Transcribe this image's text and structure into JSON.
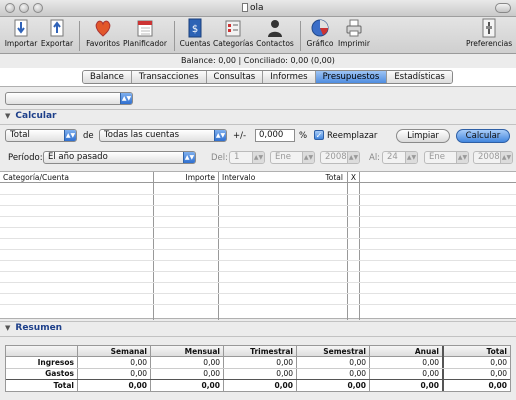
{
  "window": {
    "title": "ola"
  },
  "toolbar": {
    "importar": "Importar",
    "exportar": "Exportar",
    "favoritos": "Favoritos",
    "planificador": "Planificador",
    "cuentas": "Cuentas",
    "categorias": "Categorías",
    "contactos": "Contactos",
    "grafico": "Gráfico",
    "imprimir": "Imprimir",
    "preferencias": "Preferencias"
  },
  "balance_bar": "Balance: 0,00 | Conciliado: 0,00 (0,00)",
  "tabs": [
    "Balance",
    "Transacciones",
    "Consultas",
    "Informes",
    "Presupuestos",
    "Estadísticas"
  ],
  "active_tab": "Presupuestos",
  "calcular_section": {
    "title": "Calcular",
    "type_select": "Total",
    "de_label": "de",
    "accounts_select": "Todas las cuentas",
    "plusminus_label": "+/-",
    "percent_value": "0,000",
    "percent_sign": "%",
    "reemplazar_label": "Reemplazar",
    "reemplazar_checked": true,
    "limpiar_button": "Limpiar",
    "calcular_button": "Calcular",
    "periodo_label": "Período:",
    "periodo_select": "El año pasado",
    "del_label": "Del:",
    "del_day": "1",
    "del_month": "Ene",
    "del_year": "2008",
    "al_label": "Al:",
    "al_day": "24",
    "al_month": "Ene",
    "al_year": "2008"
  },
  "grid": {
    "headers": [
      "Categoría/Cuenta",
      "Importe",
      "Intervalo",
      "Total",
      "X"
    ]
  },
  "resumen_section": {
    "title": "Resumen",
    "columns": [
      "Semanal",
      "Mensual",
      "Trimestral",
      "Semestral",
      "Anual",
      "Total"
    ],
    "rows": [
      {
        "label": "Ingresos",
        "values": [
          "0,00",
          "0,00",
          "0,00",
          "0,00",
          "0,00",
          "0,00"
        ]
      },
      {
        "label": "Gastos",
        "values": [
          "0,00",
          "0,00",
          "0,00",
          "0,00",
          "0,00",
          "0,00"
        ]
      },
      {
        "label": "Total",
        "values": [
          "0,00",
          "0,00",
          "0,00",
          "0,00",
          "0,00",
          "0,00"
        ]
      }
    ]
  },
  "colors": {
    "accent": "#4286de",
    "section_title": "#1d3f8a",
    "heart": "#e2572b"
  }
}
